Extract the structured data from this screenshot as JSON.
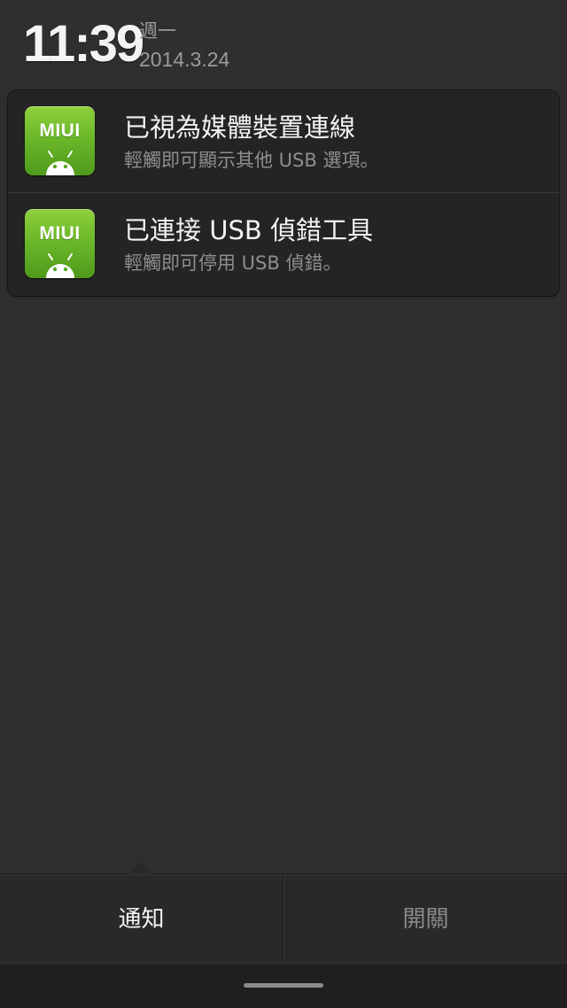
{
  "header": {
    "time": "11:39",
    "weekday": "週一",
    "date": "2014.3.24"
  },
  "notifications": [
    {
      "app_icon": "miui-android-icon",
      "app_icon_label": "MIUI",
      "title": "已視為媒體裝置連線",
      "text": "輕觸即可顯示其他 USB 選項。"
    },
    {
      "app_icon": "miui-android-icon",
      "app_icon_label": "MIUI",
      "title": "已連接 USB 偵錯工具",
      "text": "輕觸即可停用 USB 偵錯。"
    }
  ],
  "tabs": {
    "notifications_label": "通知",
    "toggles_label": "開關",
    "active": "notifications"
  },
  "colors": {
    "background": "#2e2e30",
    "icon_green": "#6bb82a",
    "active_tab_text": "#f4f4f4",
    "inactive_tab_text": "#8a8a8c"
  }
}
